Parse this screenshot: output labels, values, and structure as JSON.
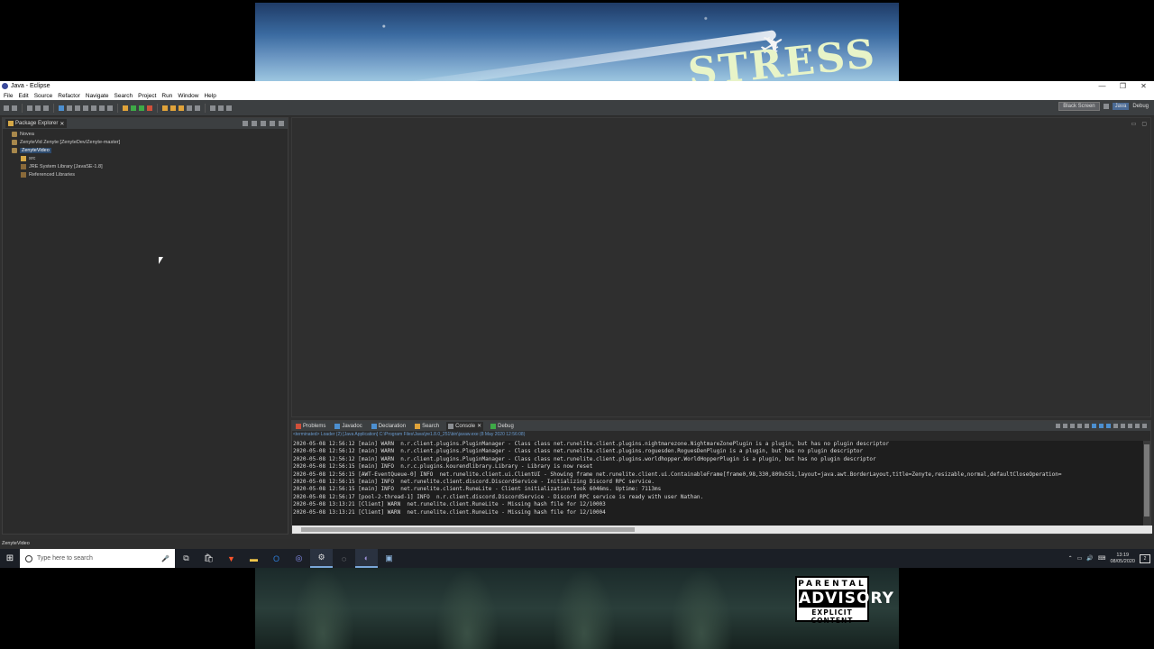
{
  "window": {
    "title": "Java - Eclipse",
    "controls": [
      "—",
      "❐",
      "✕"
    ]
  },
  "menu": [
    "File",
    "Edit",
    "Source",
    "Refactor",
    "Navigate",
    "Search",
    "Project",
    "Run",
    "Window",
    "Help"
  ],
  "perspectives": {
    "dark_btn": "Black Screen",
    "java": "Java",
    "debug": "Debug"
  },
  "package_explorer": {
    "tab_label": "Package Explorer",
    "items": [
      {
        "label": "Novea",
        "type": "project"
      },
      {
        "label": "ZenyteVid Zenyte [ZenyteDev/Zenyte-master]",
        "type": "project"
      },
      {
        "label": "ZenyteVideo",
        "type": "project",
        "selected": true
      },
      {
        "label": "src",
        "type": "package"
      },
      {
        "label": "JRE System Library [JavaSE-1.8]",
        "type": "lib"
      },
      {
        "label": "Referenced Libraries",
        "type": "lib"
      }
    ]
  },
  "bottom_panel": {
    "tabs": [
      {
        "label": "Problems",
        "active": false
      },
      {
        "label": "Javadoc",
        "active": false
      },
      {
        "label": "Declaration",
        "active": false
      },
      {
        "label": "Search",
        "active": false
      },
      {
        "label": "Console",
        "active": true
      },
      {
        "label": "Debug",
        "active": false
      }
    ],
    "terminated_line": "<terminated> Loader (2) [Java Application] C:\\Program Files\\Java\\jre1.8.0_251\\bin\\javaw.exe (8 May 2020 12:56:08)",
    "console_lines": [
      "2020-05-08 12:56:12 [main] WARN  n.r.client.plugins.PluginManager - Class class net.runelite.client.plugins.nightmarezone.NightmareZonePlugin is a plugin, but has no plugin descriptor",
      "2020-05-08 12:56:12 [main] WARN  n.r.client.plugins.PluginManager - Class class net.runelite.client.plugins.roguesden.RoguesDenPlugin is a plugin, but has no plugin descriptor",
      "2020-05-08 12:56:12 [main] WARN  n.r.client.plugins.PluginManager - Class class net.runelite.client.plugins.worldhopper.WorldHopperPlugin is a plugin, but has no plugin descriptor",
      "2020-05-08 12:56:15 [main] INFO  n.r.c.plugins.kourendlibrary.Library - Library is now reset",
      "2020-05-08 12:56:15 [AWT-EventQueue-0] INFO  net.runelite.client.ui.ClientUI - Showing frame net.runelite.client.ui.ContainableFrame[frame0,98,330,809x551,layout=java.awt.BorderLayout,title=Zenyte,resizable,normal,defaultCloseOperation=",
      "2020-05-08 12:56:15 [main] INFO  net.runelite.client.discord.DiscordService - Initializing Discord RPC service.",
      "2020-05-08 12:56:15 [main] INFO  net.runelite.client.RuneLite - Client initialization took 6046ms. Uptime: 7113ms",
      "2020-05-08 12:56:17 [pool-2-thread-1] INFO  n.r.client.discord.DiscordService - Discord RPC service is ready with user Nathan.",
      "2020-05-08 13:13:21 [Client] WARN  net.runelite.client.RuneLite - Missing hash file for 12/10003",
      "2020-05-08 13:13:21 [Client] WARN  net.runelite.client.RuneLite - Missing hash file for 12/10004"
    ]
  },
  "statusbar": {
    "text": "ZenyteVideo"
  },
  "taskbar": {
    "search_placeholder": "Type here to search",
    "clock_time": "13:19",
    "clock_date": "08/05/2020",
    "notification_count": "2"
  },
  "background_art": {
    "top_text": "STRESS",
    "advisory_line1": "PARENTAL",
    "advisory_line2": "ADVISORY",
    "advisory_line3": "EXPLICIT CONTENT"
  }
}
